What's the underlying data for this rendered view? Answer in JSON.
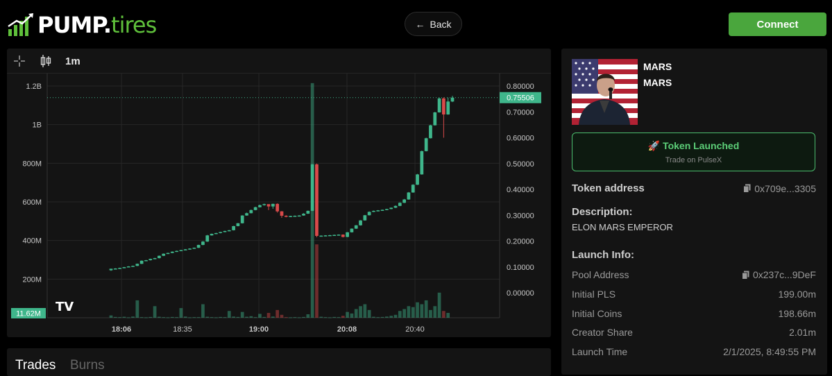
{
  "header": {
    "logo_pump": "PUMP",
    "logo_dot": ".",
    "logo_tires": "tires",
    "back_label": "Back",
    "connect_label": "Connect"
  },
  "chart_toolbar": {
    "interval": "1m",
    "icons": [
      "crosshair-icon",
      "candlestick-icon"
    ]
  },
  "chart_data": {
    "type": "candlestick",
    "price_axis_ticks": [
      "0.80000",
      "0.70000",
      "0.60000",
      "0.50000",
      "0.40000",
      "0.30000",
      "0.20000",
      "0.10000",
      "0.00000"
    ],
    "current_price_label": "0.75506",
    "current_price": 0.75506,
    "volume_axis_ticks": [
      "1.2B",
      "1B",
      "800M",
      "600M",
      "400M",
      "200M"
    ],
    "volume_badge": "11.62M",
    "time_ticks": [
      {
        "label": "18:06",
        "bold": true
      },
      {
        "label": "18:35",
        "bold": false
      },
      {
        "label": "19:00",
        "bold": true
      },
      {
        "label": "20:08",
        "bold": true
      },
      {
        "label": "20:40",
        "bold": false
      }
    ],
    "up_color": "#3fb68b",
    "down_color": "#d94a4a",
    "candles_ohlc": [
      [
        0.087,
        0.093,
        0.085,
        0.093
      ],
      [
        0.093,
        0.095,
        0.09,
        0.094
      ],
      [
        0.094,
        0.097,
        0.093,
        0.096
      ],
      [
        0.096,
        0.1,
        0.095,
        0.099
      ],
      [
        0.099,
        0.103,
        0.098,
        0.102
      ],
      [
        0.102,
        0.105,
        0.101,
        0.104
      ],
      [
        0.104,
        0.113,
        0.103,
        0.112
      ],
      [
        0.112,
        0.125,
        0.111,
        0.124
      ],
      [
        0.124,
        0.127,
        0.123,
        0.126
      ],
      [
        0.126,
        0.132,
        0.125,
        0.131
      ],
      [
        0.131,
        0.135,
        0.13,
        0.134
      ],
      [
        0.134,
        0.144,
        0.133,
        0.143
      ],
      [
        0.143,
        0.152,
        0.142,
        0.151
      ],
      [
        0.151,
        0.155,
        0.15,
        0.154
      ],
      [
        0.154,
        0.16,
        0.153,
        0.159
      ],
      [
        0.159,
        0.163,
        0.158,
        0.162
      ],
      [
        0.162,
        0.166,
        0.161,
        0.165
      ],
      [
        0.165,
        0.169,
        0.164,
        0.168
      ],
      [
        0.168,
        0.172,
        0.167,
        0.171
      ],
      [
        0.171,
        0.175,
        0.17,
        0.174
      ],
      [
        0.174,
        0.186,
        0.173,
        0.185
      ],
      [
        0.185,
        0.2,
        0.184,
        0.198
      ],
      [
        0.198,
        0.224,
        0.197,
        0.222
      ],
      [
        0.222,
        0.229,
        0.221,
        0.228
      ],
      [
        0.228,
        0.232,
        0.227,
        0.231
      ],
      [
        0.231,
        0.236,
        0.23,
        0.235
      ],
      [
        0.235,
        0.24,
        0.234,
        0.239
      ],
      [
        0.239,
        0.243,
        0.238,
        0.242
      ],
      [
        0.242,
        0.259,
        0.241,
        0.258
      ],
      [
        0.258,
        0.27,
        0.257,
        0.269
      ],
      [
        0.269,
        0.3,
        0.268,
        0.299
      ],
      [
        0.299,
        0.31,
        0.298,
        0.308
      ],
      [
        0.308,
        0.322,
        0.307,
        0.32
      ],
      [
        0.32,
        0.333,
        0.319,
        0.331
      ],
      [
        0.331,
        0.341,
        0.33,
        0.339
      ],
      [
        0.339,
        0.345,
        0.337,
        0.343
      ],
      [
        0.343,
        0.342,
        0.32,
        0.334
      ],
      [
        0.334,
        0.345,
        0.325,
        0.344
      ],
      [
        0.344,
        0.346,
        0.31,
        0.315
      ],
      [
        0.315,
        0.316,
        0.29,
        0.298
      ],
      [
        0.298,
        0.3,
        0.292,
        0.296
      ],
      [
        0.296,
        0.298,
        0.293,
        0.297
      ],
      [
        0.297,
        0.299,
        0.294,
        0.298
      ],
      [
        0.298,
        0.3,
        0.295,
        0.299
      ],
      [
        0.299,
        0.308,
        0.298,
        0.306
      ],
      [
        0.306,
        0.318,
        0.305,
        0.317
      ],
      [
        0.317,
        0.498,
        0.316,
        0.497
      ],
      [
        0.497,
        0.5,
        0.215,
        0.22
      ],
      [
        0.22,
        0.222,
        0.218,
        0.221
      ],
      [
        0.221,
        0.223,
        0.219,
        0.222
      ],
      [
        0.222,
        0.224,
        0.22,
        0.223
      ],
      [
        0.223,
        0.225,
        0.221,
        0.224
      ],
      [
        0.224,
        0.226,
        0.222,
        0.225
      ],
      [
        0.225,
        0.226,
        0.214,
        0.216
      ],
      [
        0.216,
        0.235,
        0.215,
        0.234
      ],
      [
        0.234,
        0.249,
        0.233,
        0.248
      ],
      [
        0.248,
        0.262,
        0.247,
        0.261
      ],
      [
        0.261,
        0.281,
        0.26,
        0.28
      ],
      [
        0.28,
        0.301,
        0.279,
        0.3
      ],
      [
        0.3,
        0.315,
        0.299,
        0.313
      ],
      [
        0.313,
        0.318,
        0.312,
        0.317
      ],
      [
        0.317,
        0.32,
        0.315,
        0.319
      ],
      [
        0.319,
        0.322,
        0.317,
        0.321
      ],
      [
        0.321,
        0.325,
        0.32,
        0.324
      ],
      [
        0.324,
        0.33,
        0.323,
        0.329
      ],
      [
        0.329,
        0.338,
        0.328,
        0.336
      ],
      [
        0.336,
        0.35,
        0.335,
        0.348
      ],
      [
        0.348,
        0.363,
        0.347,
        0.361
      ],
      [
        0.361,
        0.39,
        0.36,
        0.388
      ],
      [
        0.388,
        0.42,
        0.387,
        0.418
      ],
      [
        0.418,
        0.46,
        0.417,
        0.458
      ],
      [
        0.458,
        0.55,
        0.457,
        0.548
      ],
      [
        0.548,
        0.6,
        0.547,
        0.598
      ],
      [
        0.598,
        0.65,
        0.597,
        0.648
      ],
      [
        0.648,
        0.7,
        0.647,
        0.698
      ],
      [
        0.698,
        0.755,
        0.697,
        0.752
      ],
      [
        0.752,
        0.756,
        0.6,
        0.69
      ],
      [
        0.69,
        0.755,
        0.689,
        0.74
      ],
      [
        0.74,
        0.762,
        0.738,
        0.755
      ]
    ],
    "volumes_m": [
      12,
      4,
      3,
      5,
      2,
      6,
      90,
      3,
      2,
      4,
      60,
      5,
      3,
      2,
      4,
      3,
      50,
      6,
      2,
      3,
      3,
      70,
      5,
      3,
      2,
      4,
      3,
      35,
      6,
      4,
      30,
      5,
      8,
      3,
      20,
      4,
      25,
      6,
      40,
      15,
      3,
      2,
      3,
      2,
      4,
      18,
      1215,
      380,
      5,
      3,
      2,
      4,
      3,
      10,
      30,
      22,
      45,
      60,
      70,
      40,
      5,
      3,
      4,
      6,
      10,
      15,
      35,
      45,
      60,
      55,
      80,
      70,
      90,
      40,
      60,
      130,
      35,
      25
    ]
  },
  "token": {
    "name": "MARS",
    "symbol": "MARS",
    "launched_title": "🚀 Token Launched",
    "launched_sub": "Trade on PulseX",
    "address_label": "Token address",
    "address_value": "0x709e...3305",
    "description_label": "Description:",
    "description": "ELON MARS EMPEROR",
    "launch_info_label": "Launch Info:",
    "launch_info": [
      {
        "label": "Pool Address",
        "value": "0x237c...9DeF"
      },
      {
        "label": "Initial PLS",
        "value": "199.00m"
      },
      {
        "label": "Initial Coins",
        "value": "198.66m"
      },
      {
        "label": "Creator Share",
        "value": "2.01m"
      },
      {
        "label": "Launch Time",
        "value": "2/1/2025, 8:49:55 PM"
      }
    ]
  },
  "bottom_tabs": [
    "Trades",
    "Burns"
  ]
}
